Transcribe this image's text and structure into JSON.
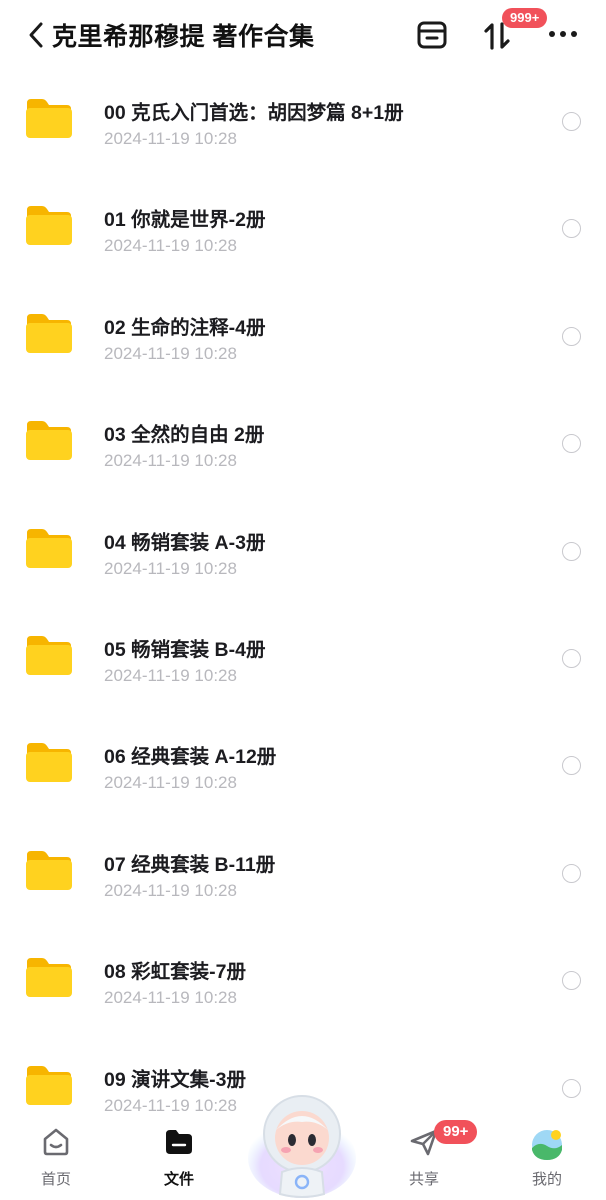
{
  "header": {
    "title": "克里希那穆提 著作合集",
    "badge": "999+",
    "icons": [
      "back-chevron-icon",
      "trash-icon",
      "transfer-sort-icon",
      "more-icon"
    ]
  },
  "files": [
    {
      "name": "00 克氏入门首选：胡因梦篇 8+1册",
      "date": "2024-11-19 10:28"
    },
    {
      "name": "01 你就是世界-2册",
      "date": "2024-11-19 10:28"
    },
    {
      "name": "02 生命的注释-4册",
      "date": "2024-11-19 10:28"
    },
    {
      "name": "03 全然的自由 2册",
      "date": "2024-11-19 10:28"
    },
    {
      "name": "04 畅销套装 A-3册",
      "date": "2024-11-19 10:28"
    },
    {
      "name": "05 畅销套装 B-4册",
      "date": "2024-11-19 10:28"
    },
    {
      "name": "06 经典套装 A-12册",
      "date": "2024-11-19 10:28"
    },
    {
      "name": "07 经典套装 B-11册",
      "date": "2024-11-19 10:28"
    },
    {
      "name": "08 彩虹套装-7册",
      "date": "2024-11-19 10:28"
    },
    {
      "name": "09 演讲文集-3册",
      "date": "2024-11-19 10:28"
    }
  ],
  "tabbar": {
    "home": "首页",
    "files": "文件",
    "share": "共享",
    "mine": "我的",
    "share_badge": "99+"
  },
  "colors": {
    "folder": "#ffd21f",
    "badge": "#f1515a",
    "date_text": "#b8b8bd"
  }
}
